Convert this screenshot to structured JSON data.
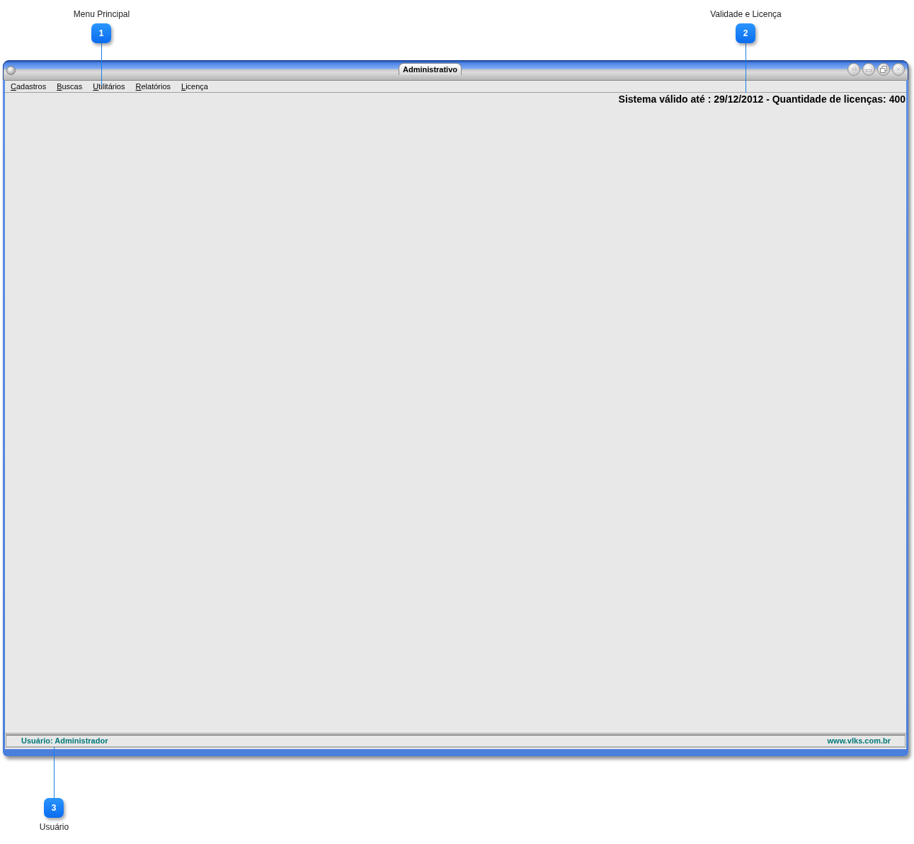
{
  "callouts": [
    {
      "number": "1",
      "label": "Menu Principal"
    },
    {
      "number": "2",
      "label": "Validade e Licença"
    },
    {
      "number": "3",
      "label": "Usuário"
    }
  ],
  "window": {
    "title": "Administrativo"
  },
  "menu": [
    "Cadastros",
    "Buscas",
    "Utilitários",
    "Relatórios",
    "Licença"
  ],
  "license_notice": "Sistema válido até : 29/12/2012 - Quantidade de licenças: 400",
  "status_bar": {
    "user": "Usuário: Administrador",
    "website": "www.vlks.com.br"
  }
}
